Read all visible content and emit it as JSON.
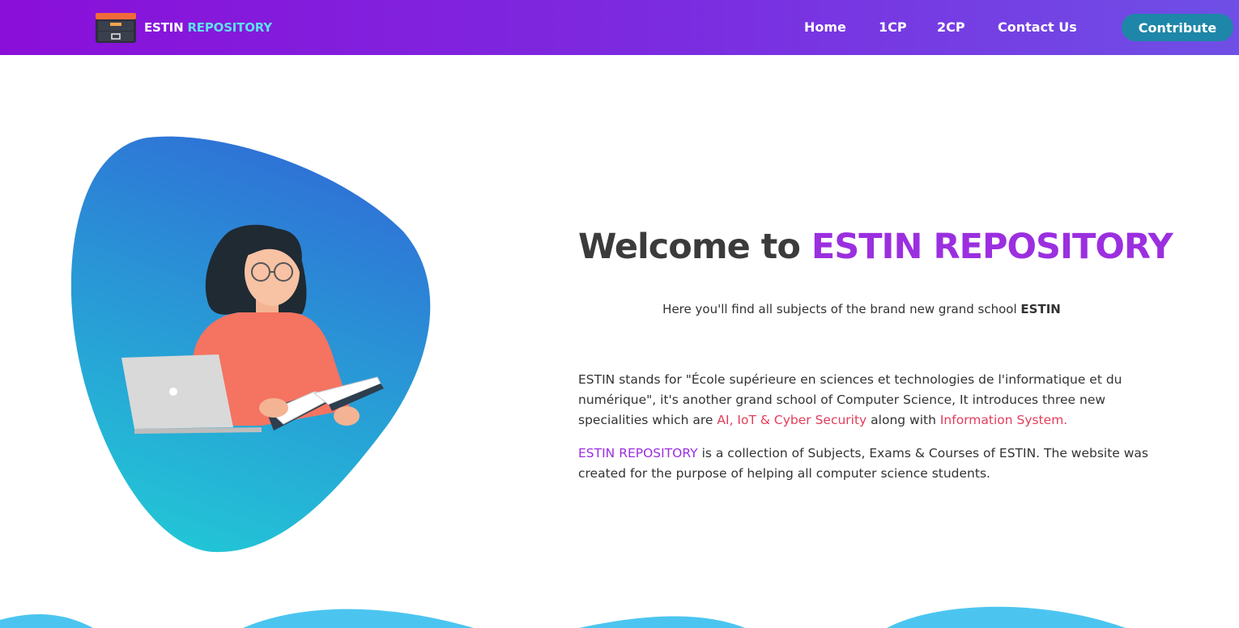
{
  "brand": {
    "name_part1": "ESTIN",
    "name_part2": "REPOSITORY"
  },
  "nav": {
    "items": [
      {
        "label": "Home"
      },
      {
        "label": "1CP"
      },
      {
        "label": "2CP"
      },
      {
        "label": "Contact Us"
      }
    ],
    "contribute_label": "Contribute"
  },
  "hero": {
    "title_part1": "Welcome to",
    "title_part2": "ESTIN REPOSITORY",
    "subtitle_part1": "Here you'll find all subjects of the brand new grand school",
    "subtitle_part2": "ESTIN",
    "p1_text": "ESTIN stands for \"École supérieure en sciences et technologies de l'informatique et du numérique\", it's another grand school of Computer Science, It introduces three new specialities which are",
    "p1_red1": "AI, IoT & Cyber Security",
    "p1_mid": "along with",
    "p1_red2": "Information System.",
    "p2_accent": "ESTIN REPOSITORY",
    "p2_text": "is a collection of Subjects, Exams & Courses of ESTIN. The website was created for the purpose of helping all computer science students."
  },
  "colors": {
    "nav_gradient_start": "#8a0fd9",
    "nav_gradient_end": "#6f4fe6",
    "accent_purple": "#9b2fe0",
    "accent_red": "#e23d5a",
    "contribute_bg": "#1e86a8",
    "blob_top": "#2f6fd6",
    "blob_bottom": "#22c6d6",
    "wave": "#4bc5f0"
  },
  "icons": {
    "brand": "file-cabinet-icon"
  }
}
